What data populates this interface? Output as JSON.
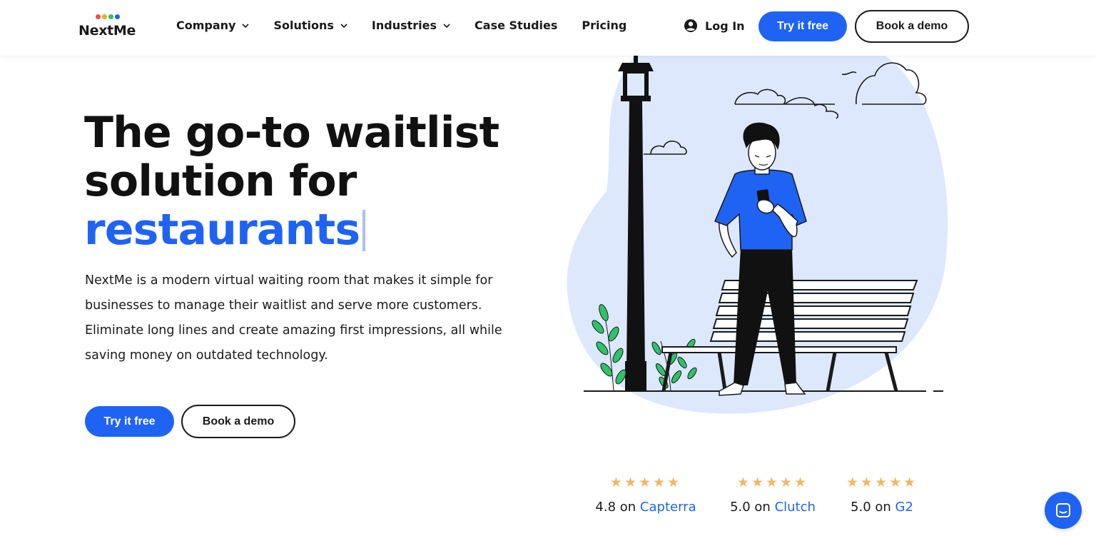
{
  "brand": {
    "name": "NextMe",
    "dot_colors": [
      "#f04a4a",
      "#f5a623",
      "#2ec26a",
      "#1f63f5"
    ]
  },
  "nav": {
    "items": [
      {
        "label": "Company",
        "has_dropdown": true
      },
      {
        "label": "Solutions",
        "has_dropdown": true
      },
      {
        "label": "Industries",
        "has_dropdown": true
      },
      {
        "label": "Case Studies",
        "has_dropdown": false
      },
      {
        "label": "Pricing",
        "has_dropdown": false
      }
    ],
    "login_label": "Log In",
    "try_label": "Try it free",
    "demo_label": "Book a demo"
  },
  "hero": {
    "title_line1": "The go-to waitlist",
    "title_line2": "solution for",
    "title_accent": "restaurants",
    "description": "NextMe is a modern virtual waiting room that makes it simple for businesses to manage their waitlist and serve more customers. Eliminate long lines and create amazing first impressions, all while saving money on outdated technology.",
    "try_label": "Try it free",
    "demo_label": "Book a demo"
  },
  "ratings": [
    {
      "stars": "★★★★★",
      "score": "4.8 on",
      "source": "Capterra"
    },
    {
      "stars": "★★★★★",
      "score": "5.0 on",
      "source": "Clutch"
    },
    {
      "stars": "★★★★★",
      "score": "5.0 on",
      "source": "G2"
    }
  ],
  "colors": {
    "accent": "#1f63f5",
    "star": "#f2b766",
    "blob": "#dde8fd",
    "plant": "#2ec26a"
  },
  "icons": {
    "user": "user-circle-icon",
    "chevron": "chevron-down-icon",
    "chat": "chat-icon"
  }
}
